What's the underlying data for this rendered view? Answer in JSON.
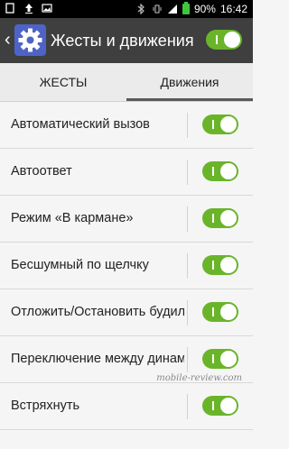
{
  "status_bar": {
    "battery_percent": "90%",
    "time": "16:42",
    "icons": [
      "sim-card-icon",
      "upload-icon",
      "image-icon",
      "bluetooth-icon",
      "vibrate-icon",
      "signal-icon",
      "battery-icon"
    ]
  },
  "app_bar": {
    "title": "Жесты и движения",
    "master_enabled": true,
    "accent": "#6ab42a",
    "icon_color": "#4e63c7"
  },
  "tabs": [
    {
      "label": "ЖЕСТЫ",
      "selected": false
    },
    {
      "label": "Движения",
      "selected": true
    }
  ],
  "settings": [
    {
      "label": "Автоматический вызов",
      "enabled": true
    },
    {
      "label": "Автоответ",
      "enabled": true
    },
    {
      "label": "Режим «В кармане»",
      "enabled": true
    },
    {
      "label": "Бесшумный по щелчку",
      "enabled": true
    },
    {
      "label": "Отложить/Остановить будильник",
      "enabled": true
    },
    {
      "label": "Переключение между динамиками",
      "enabled": true
    },
    {
      "label": "Встряхнуть",
      "enabled": true
    }
  ],
  "watermark": "mobile-review.com"
}
